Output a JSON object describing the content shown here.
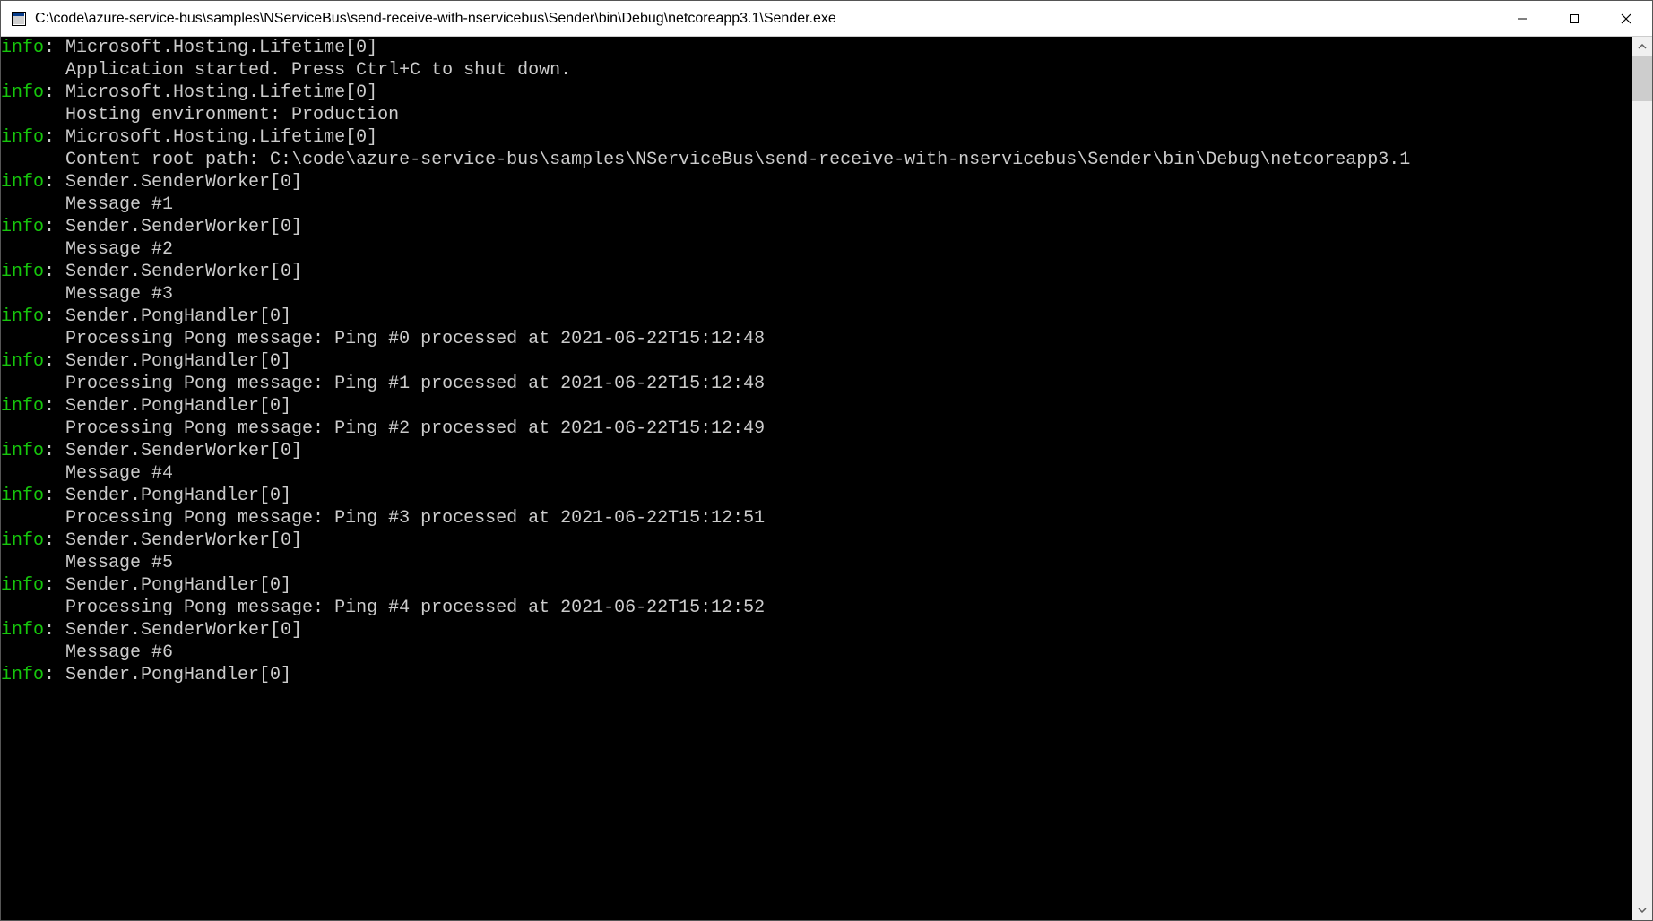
{
  "window": {
    "title": "C:\\code\\azure-service-bus\\samples\\NServiceBus\\send-receive-with-nservicebus\\Sender\\bin\\Debug\\netcoreapp3.1\\Sender.exe"
  },
  "console": {
    "lines": [
      {
        "level": "info",
        "source": "Microsoft.Hosting.Lifetime[0]",
        "message": "Application started. Press Ctrl+C to shut down."
      },
      {
        "level": "info",
        "source": "Microsoft.Hosting.Lifetime[0]",
        "message": "Hosting environment: Production"
      },
      {
        "level": "info",
        "source": "Microsoft.Hosting.Lifetime[0]",
        "message": "Content root path: C:\\code\\azure-service-bus\\samples\\NServiceBus\\send-receive-with-nservicebus\\Sender\\bin\\Debug\\netcoreapp3.1"
      },
      {
        "level": "info",
        "source": "Sender.SenderWorker[0]",
        "message": "Message #1"
      },
      {
        "level": "info",
        "source": "Sender.SenderWorker[0]",
        "message": "Message #2"
      },
      {
        "level": "info",
        "source": "Sender.SenderWorker[0]",
        "message": "Message #3"
      },
      {
        "level": "info",
        "source": "Sender.PongHandler[0]",
        "message": "Processing Pong message: Ping #0 processed at 2021-06-22T15:12:48"
      },
      {
        "level": "info",
        "source": "Sender.PongHandler[0]",
        "message": "Processing Pong message: Ping #1 processed at 2021-06-22T15:12:48"
      },
      {
        "level": "info",
        "source": "Sender.PongHandler[0]",
        "message": "Processing Pong message: Ping #2 processed at 2021-06-22T15:12:49"
      },
      {
        "level": "info",
        "source": "Sender.SenderWorker[0]",
        "message": "Message #4"
      },
      {
        "level": "info",
        "source": "Sender.PongHandler[0]",
        "message": "Processing Pong message: Ping #3 processed at 2021-06-22T15:12:51"
      },
      {
        "level": "info",
        "source": "Sender.SenderWorker[0]",
        "message": "Message #5"
      },
      {
        "level": "info",
        "source": "Sender.PongHandler[0]",
        "message": "Processing Pong message: Ping #4 processed at 2021-06-22T15:12:52"
      },
      {
        "level": "info",
        "source": "Sender.SenderWorker[0]",
        "message": "Message #6"
      },
      {
        "level": "info",
        "source": "Sender.PongHandler[0]",
        "message": ""
      }
    ]
  }
}
